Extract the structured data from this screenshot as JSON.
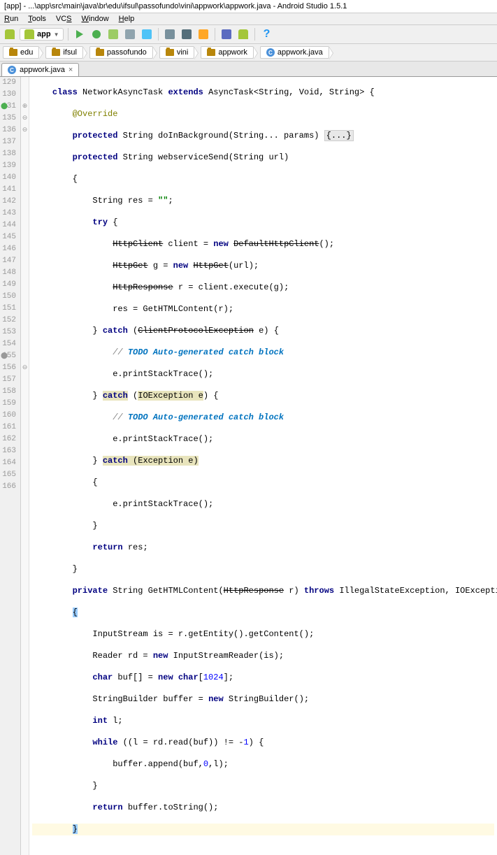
{
  "title": "[app] - ...\\app\\src\\main\\java\\br\\edu\\ifsul\\passofundo\\vini\\appwork\\appwork.java - Android Studio 1.5.1",
  "menu": {
    "run": "Run",
    "tools": "Tools",
    "vcs": "VCS",
    "window": "Window",
    "help": "Help"
  },
  "module": "app",
  "breadcrumbs": [
    "edu",
    "ifsul",
    "passofundo",
    "vini",
    "appwork",
    "appwork.java"
  ],
  "tab": {
    "name": "appwork.java",
    "close": "×"
  },
  "gutter_lines": [
    "129",
    "130",
    "131",
    "135",
    "136",
    "137",
    "138",
    "139",
    "140",
    "141",
    "142",
    "143",
    "144",
    "145",
    "146",
    "147",
    "148",
    "149",
    "150",
    "151",
    "152",
    "153",
    "154",
    "155",
    "156",
    "157",
    "158",
    "159",
    "160",
    "161",
    "162",
    "163",
    "164",
    "165",
    "166"
  ],
  "code": {
    "l129": {
      "indent": "    ",
      "p1": "class",
      "p2": " NetworkAsyncTask ",
      "p3": "extends",
      "p4": " AsyncTask<String, Void, String> {"
    },
    "l130": {
      "indent": "        ",
      "p1": "@Override"
    },
    "l131": {
      "indent": "        ",
      "p1": "protected",
      "p2": " String doInBackground(String... params) ",
      "p3": "{...}"
    },
    "l135": {
      "indent": "        ",
      "p1": "protected",
      "p2": " String webserviceSend(String url)"
    },
    "l136": {
      "indent": "        ",
      "p1": "{"
    },
    "l137": {
      "indent": "            ",
      "p1": "String res = ",
      "p2": "\"\"",
      "p3": ";"
    },
    "l138": {
      "indent": "            ",
      "p1": "try",
      "p2": " {"
    },
    "l139": {
      "indent": "                ",
      "p1": "HttpClient",
      "p2": " client = ",
      "p3": "new",
      "p4": " ",
      "p5": "DefaultHttpClient",
      "p6": "();"
    },
    "l140": {
      "indent": "                ",
      "p1": "HttpGet",
      "p2": " g = ",
      "p3": "new",
      "p4": " ",
      "p5": "HttpGet",
      "p6": "(url);"
    },
    "l141": {
      "indent": "                ",
      "p1": "HttpResponse",
      "p2": " r = client.execute(g);"
    },
    "l142": {
      "indent": "                ",
      "p1": "res = GetHTMLContent(r);"
    },
    "l143": {
      "indent": "            ",
      "p1": "} ",
      "p2": "catch",
      "p3": " (",
      "p4": "ClientProtocolException",
      "p5": " e) {"
    },
    "l144": {
      "indent": "                ",
      "p1": "// ",
      "p2": "TODO Auto-generated catch block"
    },
    "l145": {
      "indent": "                ",
      "p1": "e.printStackTrace();"
    },
    "l146": {
      "indent": "            ",
      "p1": "} ",
      "p2": "catch",
      "p3": " (",
      "p4": "IOException",
      "p5": " ",
      "p6": "e",
      "p7": ") {"
    },
    "l147": {
      "indent": "                ",
      "p1": "// ",
      "p2": "TODO Auto-generated catch block"
    },
    "l148": {
      "indent": "                ",
      "p1": "e.printStackTrace();"
    },
    "l149": {
      "indent": "            ",
      "p1": "} ",
      "p2": "catch",
      "p3": " (Exception ",
      "p4": "e",
      "p5": ")"
    },
    "l150": {
      "indent": "            ",
      "p1": "{"
    },
    "l151": {
      "indent": "                ",
      "p1": "e.printStackTrace();"
    },
    "l152": {
      "indent": "            ",
      "p1": "}"
    },
    "l153": {
      "indent": "            ",
      "p1": "return",
      "p2": " res;"
    },
    "l154": {
      "indent": "        ",
      "p1": "}"
    },
    "l155": {
      "indent": "        ",
      "p1": "private",
      "p2": " String GetHTMLContent(",
      "p3": "HttpResponse",
      "p4": " r) ",
      "p5": "throws",
      "p6": " IllegalStateException, IOException"
    },
    "l156": {
      "indent": "        ",
      "p1": "{"
    },
    "l157": {
      "indent": "            ",
      "p1": "InputStream is = r.getEntity().getContent();"
    },
    "l158": {
      "indent": "            ",
      "p1": "Reader rd = ",
      "p2": "new",
      "p3": " InputStreamReader(is);"
    },
    "l159": {
      "indent": "            ",
      "p1": "char",
      "p2": " buf[] = ",
      "p3": "new char",
      "p4": "[",
      "p5": "1024",
      "p6": "];"
    },
    "l160": {
      "indent": "            ",
      "p1": "StringBuilder buffer = ",
      "p2": "new",
      "p3": " StringBuilder();"
    },
    "l161": {
      "indent": "            ",
      "p1": "int",
      "p2": " l;"
    },
    "l162": {
      "indent": "            ",
      "p1": "while",
      "p2": " ((l = rd.read(buf)) != -",
      "p3": "1",
      "p4": ") {"
    },
    "l163": {
      "indent": "                ",
      "p1": "buffer.append(buf,",
      "p2": "0",
      "p3": ",l);"
    },
    "l164": {
      "indent": "            ",
      "p1": "}"
    },
    "l165": {
      "indent": "            ",
      "p1": "return",
      "p2": " buffer.toString();"
    },
    "l166": {
      "indent": "        ",
      "p1": "}"
    }
  }
}
